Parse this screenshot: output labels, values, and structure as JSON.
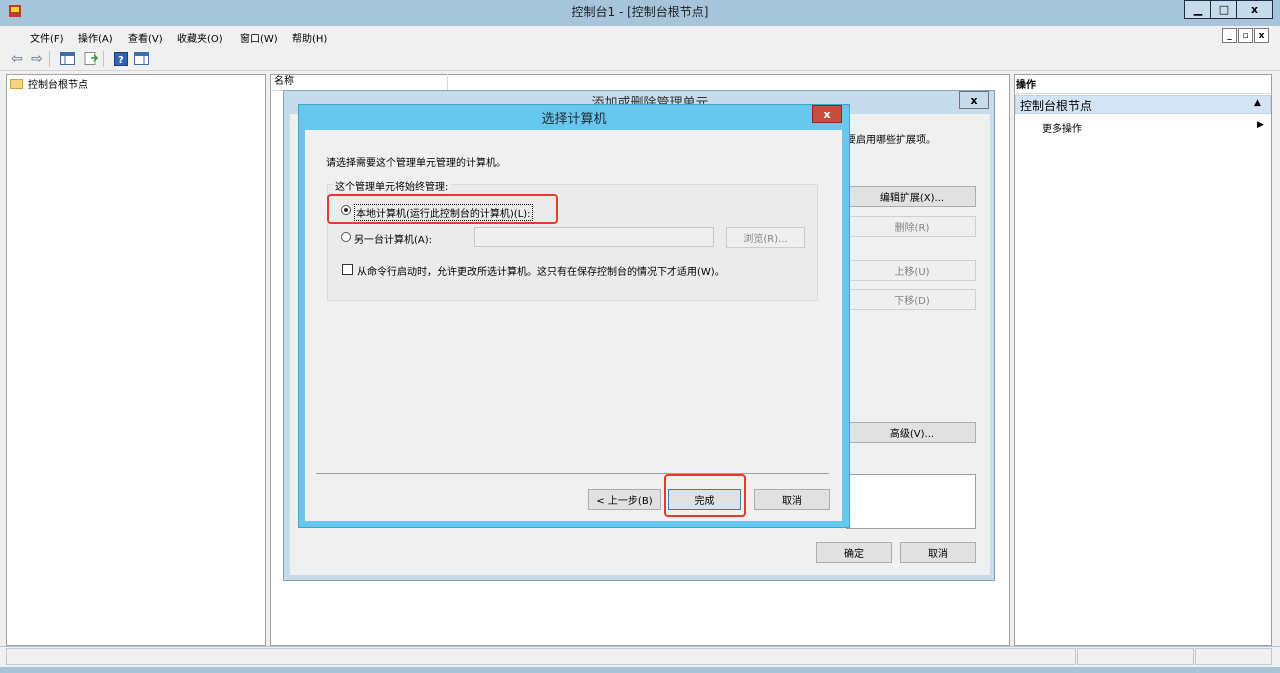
{
  "window": {
    "title": "控制台1 - [控制台根节点]",
    "app_icon": "mmc-icon"
  },
  "caption_buttons": {
    "minimize": "▁",
    "maximize": "□",
    "close": "x"
  },
  "menu": {
    "items": [
      "文件(F)",
      "操作(A)",
      "查看(V)",
      "收藏夹(O)",
      "窗口(W)",
      "帮助(H)"
    ],
    "mdi": {
      "minimize": "_",
      "restore": "▫",
      "close": "x"
    }
  },
  "toolbar": {
    "icons": [
      "back-icon",
      "forward-icon",
      "console-tree-icon",
      "export-icon",
      "help-icon",
      "action-pane-icon"
    ]
  },
  "tree": {
    "root": "控制台根节点"
  },
  "center": {
    "column_name": "名称"
  },
  "actions": {
    "header": "操作",
    "group": "控制台根节点",
    "more": "更多操作"
  },
  "snapin_dialog": {
    "title": "添加或删除管理单元",
    "hint": "要启用哪些扩展项。",
    "buttons": {
      "edit_ext": "编辑扩展(X)...",
      "remove": "删除(R)",
      "move_up": "上移(U)",
      "move_down": "下移(D)",
      "advanced": "高级(V)...",
      "ok": "确定",
      "cancel": "取消"
    }
  },
  "select_computer": {
    "title": "选择计算机",
    "instruction": "请选择需要这个管理单元管理的计算机。",
    "group_label": "这个管理单元将始终管理:",
    "local_label": "本地计算机(运行此控制台的计算机)(L):",
    "local_selected": true,
    "other_label": "另一台计算机(A):",
    "other_value": "",
    "browse": "浏览(R)...",
    "cmdline_label": "从命令行启动时，允许更改所选计算机。这只有在保存控制台的情况下才适用(W)。",
    "cmdline_checked": false,
    "back": "< 上一步(B)",
    "finish": "完成",
    "cancel": "取消"
  },
  "highlight_color": "#e53a2c"
}
